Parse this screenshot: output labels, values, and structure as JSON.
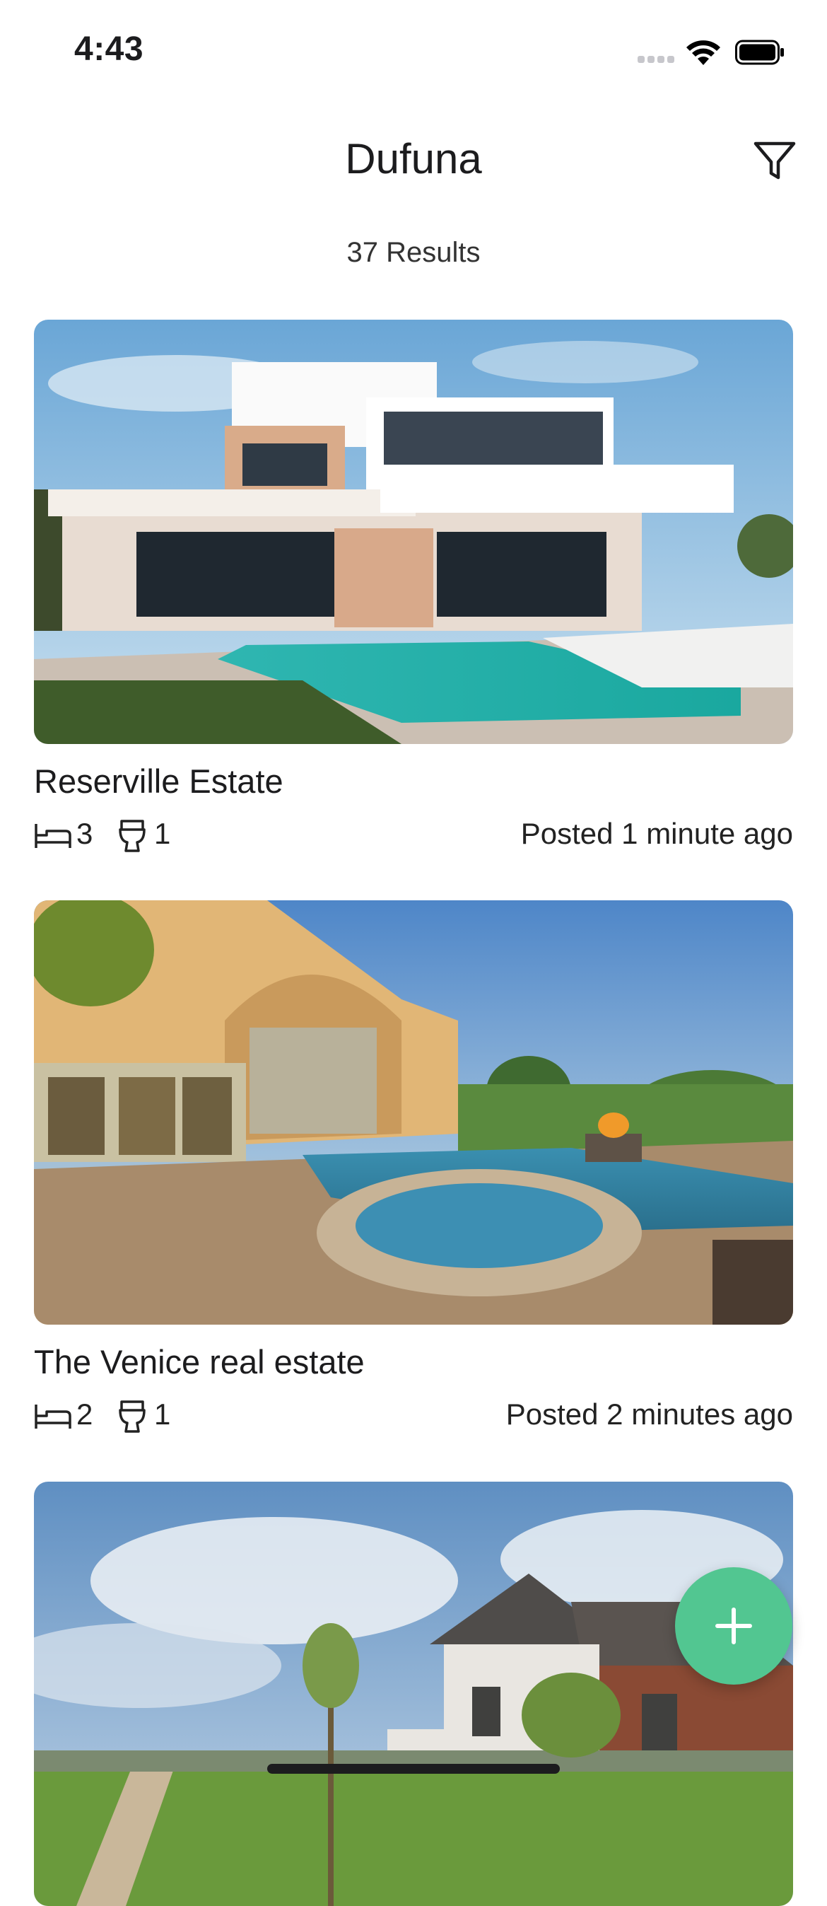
{
  "status_bar": {
    "time": "4:43",
    "icons": [
      "signal-icon",
      "wifi-icon",
      "battery-icon"
    ]
  },
  "header": {
    "title": "Dufuna",
    "filter_icon": "filter-icon"
  },
  "results_label": "37 Results",
  "listings": [
    {
      "title": "Reserville Estate",
      "beds": "3",
      "baths": "1",
      "posted": "Posted 1 minute ago"
    },
    {
      "title": "The Venice real estate",
      "beds": "2",
      "baths": "1",
      "posted": "Posted 2 minutes ago"
    },
    {
      "title": "",
      "beds": "",
      "baths": "",
      "posted": ""
    }
  ],
  "fab": {
    "icon": "plus-icon"
  },
  "colors": {
    "accent": "#52c691",
    "text": "#1c1c1e",
    "background": "#ffffff"
  }
}
